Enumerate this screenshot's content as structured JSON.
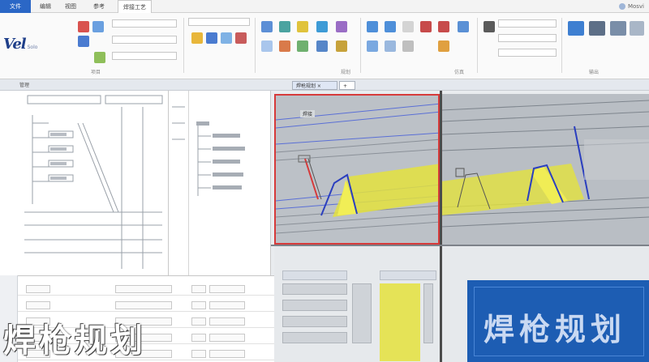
{
  "tabs": [
    {
      "label": "文件",
      "active": true
    },
    {
      "label": "编辑"
    },
    {
      "label": "视图"
    },
    {
      "label": "参考"
    },
    {
      "label": "焊接工艺"
    }
  ],
  "account": {
    "label": "Mosvi"
  },
  "brand": {
    "name": "Vel",
    "sub": "Solo"
  },
  "ribbon": {
    "group_caption_1": "项目",
    "group_caption_2": "规划",
    "group_caption_3": "仿真",
    "group_caption_4": "输出"
  },
  "doc_row": {
    "label": "管理",
    "active_tab": "焊枪规划 ×",
    "tab2": "+"
  },
  "viewport": {
    "caption": "焊接"
  },
  "caption_overlay": "焊枪规划",
  "caption_blue": "焊枪规划",
  "colors": {
    "accent": "#2b67c6",
    "highlight": "#e4e23d",
    "frame": "#d63a3a",
    "panel_blue": "#1d5db3"
  }
}
